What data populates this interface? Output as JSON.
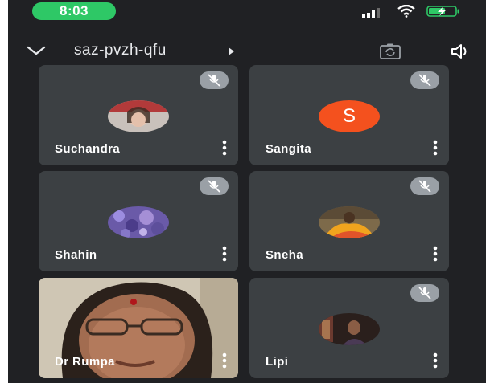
{
  "status_bar": {
    "time": "8:03",
    "accent": "#2ec866"
  },
  "header": {
    "meeting_code": "saz-pvzh-qfu"
  },
  "participants": [
    {
      "name": "Suchandra",
      "avatar": "photo",
      "muted": true
    },
    {
      "name": "Sangita",
      "avatar": "letter",
      "initial": "S",
      "avatar_color": "#f4511e",
      "muted": true
    },
    {
      "name": "Shahin",
      "avatar": "photo",
      "muted": true
    },
    {
      "name": "Sneha",
      "avatar": "photo",
      "muted": true
    },
    {
      "name": "Dr Rumpa",
      "avatar": "video",
      "muted": false
    },
    {
      "name": "Lipi",
      "avatar": "photo",
      "muted": true
    }
  ],
  "icons": {
    "collapse": "chevron-down-icon",
    "switch_camera": "switch-camera-icon",
    "speaker": "speaker-icon",
    "mute": "mic-off-icon",
    "more": "more-vert-icon"
  }
}
